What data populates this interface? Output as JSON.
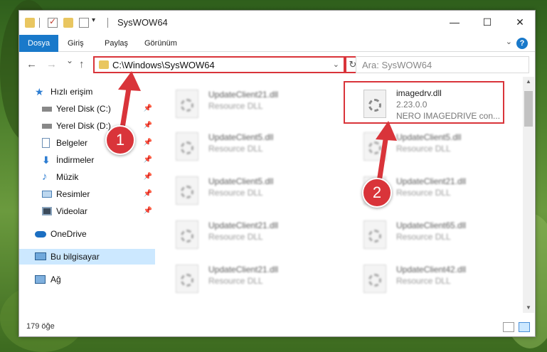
{
  "window": {
    "title": "SysWOW64",
    "controls": {
      "minimize": "—",
      "maximize": "☐",
      "close": "✕"
    }
  },
  "ribbon": {
    "tabs": [
      {
        "label": "Dosya",
        "active": true
      },
      {
        "label": "Giriş"
      },
      {
        "label": "Paylaş"
      },
      {
        "label": "Görünüm"
      }
    ],
    "help": "?"
  },
  "navigation": {
    "back": "←",
    "forward": "→",
    "recent": "⌄",
    "up": "↑",
    "address": "C:\\Windows\\SysWOW64",
    "refresh": "↻",
    "search_placeholder": "Ara: SysWOW64"
  },
  "sidebar": {
    "items": [
      {
        "label": "Hızlı erişim",
        "icon": "star-icon"
      },
      {
        "label": "Yerel Disk (C:)",
        "icon": "drive-icon"
      },
      {
        "label": "Yerel Disk (D:)",
        "icon": "drive-icon"
      },
      {
        "label": "Belgeler",
        "icon": "document-icon"
      },
      {
        "label": "İndirmeler",
        "icon": "download-icon"
      },
      {
        "label": "Müzik",
        "icon": "music-icon"
      },
      {
        "label": "Resimler",
        "icon": "picture-icon"
      },
      {
        "label": "Videolar",
        "icon": "video-icon"
      },
      {
        "label": "OneDrive",
        "icon": "cloud-icon"
      },
      {
        "label": "Bu bilgisayar",
        "icon": "computer-icon",
        "selected": true
      },
      {
        "label": "Ağ",
        "icon": "network-icon"
      }
    ],
    "pin": "📌"
  },
  "files": {
    "left": [
      {
        "name": "UpdateClient21.dll",
        "desc": "Resource DLL"
      },
      {
        "name": "UpdateClient5.dll",
        "desc": "Resource DLL"
      },
      {
        "name": "UpdateClient5.dll",
        "desc": "Resource DLL"
      },
      {
        "name": "UpdateClient21.dll",
        "desc": "Resource DLL"
      },
      {
        "name": "UpdateClient21.dll",
        "desc": "Resource DLL"
      }
    ],
    "right": [
      {
        "name": "imagedrv.dll",
        "version": "2.23.0.0",
        "desc": "NERO IMAGEDRIVE con..."
      },
      {
        "name": "UpdateClient5.dll",
        "desc": "Resource DLL"
      },
      {
        "name": "UpdateClient21.dll",
        "desc": "Resource DLL"
      },
      {
        "name": "UpdateClient65.dll",
        "desc": "Resource DLL"
      },
      {
        "name": "UpdateClient42.dll",
        "desc": "Resource DLL"
      }
    ]
  },
  "status": {
    "count": "179 öğe"
  },
  "annotations": {
    "badge1": "1",
    "badge2": "2",
    "color": "#d9343a"
  }
}
